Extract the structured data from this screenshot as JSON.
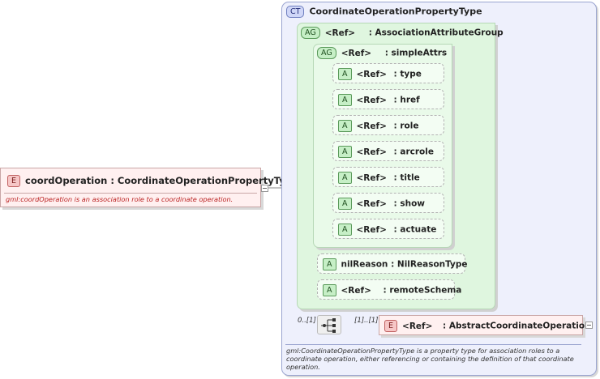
{
  "element": {
    "badge": "E",
    "name": "coordOperation",
    "type": ": CoordinateOperationPropertyType",
    "description": "gml:coordOperation is an association role to a coordinate operation."
  },
  "complex_type": {
    "badge": "CT",
    "name": "CoordinateOperationPropertyType",
    "description": "gml:CoordinateOperationPropertyType is a property type for association roles to a coordinate operation, either referencing or containing the definition of that coordinate operation."
  },
  "association_group": {
    "badge": "AG",
    "ref": "<Ref>",
    "name": ": AssociationAttributeGroup"
  },
  "simple_attrs": {
    "badge": "AG",
    "ref": "<Ref>",
    "name": ": simpleAttrs",
    "attributes": [
      {
        "badge": "A",
        "ref": "<Ref>",
        "name": ": type"
      },
      {
        "badge": "A",
        "ref": "<Ref>",
        "name": ": href"
      },
      {
        "badge": "A",
        "ref": "<Ref>",
        "name": ": role"
      },
      {
        "badge": "A",
        "ref": "<Ref>",
        "name": ": arcrole"
      },
      {
        "badge": "A",
        "ref": "<Ref>",
        "name": ": title"
      },
      {
        "badge": "A",
        "ref": "<Ref>",
        "name": ": show"
      },
      {
        "badge": "A",
        "ref": "<Ref>",
        "name": ": actuate"
      }
    ]
  },
  "nil_reason": {
    "badge": "A",
    "name": "nilReason",
    "type": ": NilReasonType"
  },
  "remote_schema": {
    "badge": "A",
    "ref": "<Ref>",
    "name": ": remoteSchema"
  },
  "sequence": {
    "cardinality_left": "0..[1]",
    "cardinality_right": "[1]..[1]"
  },
  "abstract_op": {
    "badge": "E",
    "ref": "<Ref>",
    "name": ": AbstractCoordinateOperation"
  }
}
